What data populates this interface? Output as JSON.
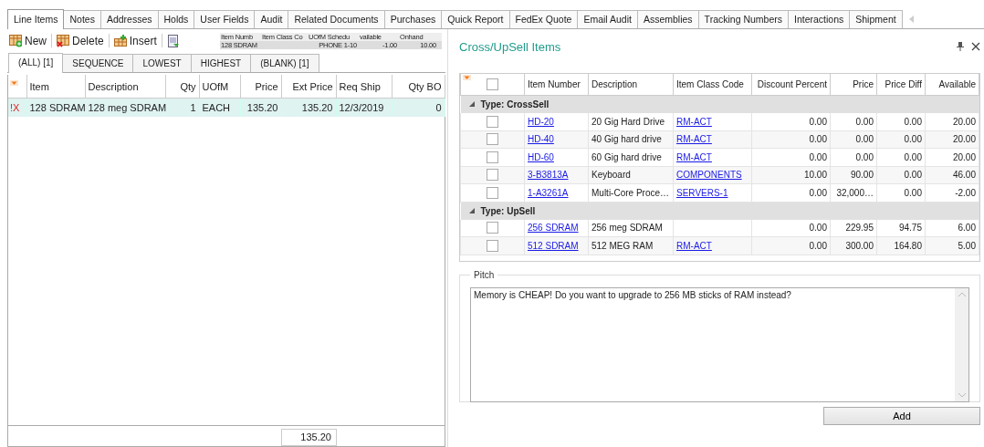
{
  "tabs": [
    {
      "label": "Line Items",
      "selected": true
    },
    {
      "label": "Notes",
      "selected": false
    },
    {
      "label": "Addresses",
      "selected": false
    },
    {
      "label": "Holds",
      "selected": false
    },
    {
      "label": "User Fields",
      "selected": false
    },
    {
      "label": "Audit",
      "selected": false
    },
    {
      "label": "Related Documents",
      "selected": false
    },
    {
      "label": "Purchases",
      "selected": false
    },
    {
      "label": "Quick Report",
      "selected": false
    },
    {
      "label": "FedEx Quote",
      "selected": false
    },
    {
      "label": "Email Audit",
      "selected": false
    },
    {
      "label": "Assemblies",
      "selected": false
    },
    {
      "label": "Tracking Numbers",
      "selected": false
    },
    {
      "label": "Interactions",
      "selected": false
    },
    {
      "label": "Shipment",
      "selected": false
    }
  ],
  "toolbar": [
    {
      "kind": "new",
      "label": "New"
    },
    {
      "kind": "delete",
      "label": "Delete"
    },
    {
      "kind": "insert",
      "label": "Insert"
    },
    {
      "kind": "export"
    }
  ],
  "lookup": {
    "columns": [
      "Item Numb",
      "Item Class Co",
      "UOfM Schedu",
      "vailable",
      "Onhand"
    ],
    "row": {
      "item_number": "128 SDRAM",
      "uofm_schedule": "PHONE 1-10",
      "available": "-1.00",
      "onhand": "10.00"
    }
  },
  "filter_tabs": [
    {
      "label": "(ALL) [1]",
      "selected": true
    },
    {
      "label": "SEQUENCE",
      "selected": false
    },
    {
      "label": "LOWEST",
      "selected": false
    },
    {
      "label": "HIGHEST",
      "selected": false
    },
    {
      "label": "(BLANK) [1]",
      "selected": false
    }
  ],
  "line_items": {
    "columns": [
      "Item",
      "Description",
      "Qty",
      "UOfM",
      "Price",
      "Ext Price",
      "Req Ship",
      "Qty BO"
    ],
    "rows": [
      {
        "status": "!X",
        "cells": [
          "128 SDRAM",
          "128 meg SDRAM",
          "1",
          "EACH",
          "135.20",
          "135.20",
          "12/3/2019",
          "0"
        ],
        "selected": true
      }
    ],
    "total": "135.20"
  },
  "cross_upsell": {
    "title": "Cross/UpSell Items",
    "columns": [
      {
        "label": "Item Number",
        "kind": "link"
      },
      {
        "label": "Description",
        "kind": "text"
      },
      {
        "label": "Item Class Code",
        "kind": "link"
      },
      {
        "label": "Discount Percent",
        "kind": "number"
      },
      {
        "label": "Price",
        "kind": "number"
      },
      {
        "label": "Price Diff",
        "kind": "number"
      },
      {
        "label": "Available",
        "kind": "number"
      }
    ],
    "header_checked": false,
    "groups": [
      {
        "label": "Type: CrossSell",
        "expanded": true,
        "rows": [
          {
            "checked": false,
            "item_number": "HD-20",
            "description": "20 Gig Hard Drive",
            "item_class_code": "RM-ACT",
            "discount_percent": "0.00",
            "price": "0.00",
            "price_diff": "0.00",
            "available": "20.00"
          },
          {
            "checked": false,
            "item_number": "HD-40",
            "description": "40 Gig hard drive",
            "item_class_code": "RM-ACT",
            "discount_percent": "0.00",
            "price": "0.00",
            "price_diff": "0.00",
            "available": "20.00"
          },
          {
            "checked": false,
            "item_number": "HD-60",
            "description": "60 Gig hard drive",
            "item_class_code": "RM-ACT",
            "discount_percent": "0.00",
            "price": "0.00",
            "price_diff": "0.00",
            "available": "20.00"
          },
          {
            "checked": false,
            "item_number": "3-B3813A",
            "description": "Keyboard",
            "item_class_code": "COMPONENTS",
            "discount_percent": "10.00",
            "price": "90.00",
            "price_diff": "0.00",
            "available": "46.00"
          },
          {
            "checked": false,
            "item_number": "1-A3261A",
            "description": "Multi-Core Proce…",
            "item_class_code": "SERVERS-1",
            "discount_percent": "0.00",
            "price": "32,000…",
            "price_diff": "0.00",
            "available": "-2.00"
          }
        ]
      },
      {
        "label": "Type: UpSell",
        "expanded": true,
        "rows": [
          {
            "checked": false,
            "item_number": "256 SDRAM",
            "description": "256 meg SDRAM",
            "discount_percent": "0.00",
            "price": "229.95",
            "price_diff": "94.75",
            "available": "6.00"
          },
          {
            "checked": false,
            "item_number": "512 SDRAM",
            "description": "512 MEG RAM",
            "item_class_code": "RM-ACT",
            "discount_percent": "0.00",
            "price": "300.00",
            "price_diff": "164.80",
            "available": "5.00"
          }
        ]
      }
    ],
    "pitch": {
      "label": "Pitch",
      "value": "Memory is CHEAP! Do you want to upgrade to 256 MB sticks of RAM instead?"
    },
    "add_button": "Add"
  }
}
